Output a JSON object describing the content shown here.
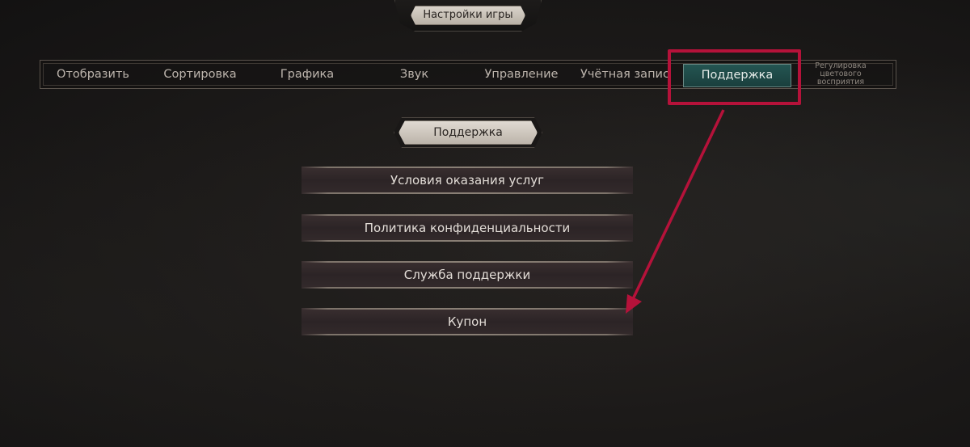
{
  "header": {
    "title": "Настройки игры"
  },
  "tabs": [
    {
      "label": "Отобразить"
    },
    {
      "label": "Сортировка"
    },
    {
      "label": "Графика"
    },
    {
      "label": "Звук"
    },
    {
      "label": "Управление"
    },
    {
      "label": "Учётная запись"
    },
    {
      "label": "Поддержка",
      "active": true
    },
    {
      "label": "Регулировка цветового восприятия"
    }
  ],
  "section": {
    "title": "Поддержка"
  },
  "menu": [
    {
      "label": "Условия оказания услуг"
    },
    {
      "label": "Политика конфиденциальности"
    },
    {
      "label": "Служба поддержки"
    },
    {
      "label": "Купон"
    }
  ],
  "annotation": {
    "color": "#b5123a"
  },
  "colors": {
    "active_tab": "#1f4a47",
    "plaque": "#d2cbc1",
    "button": "#2f2728"
  }
}
